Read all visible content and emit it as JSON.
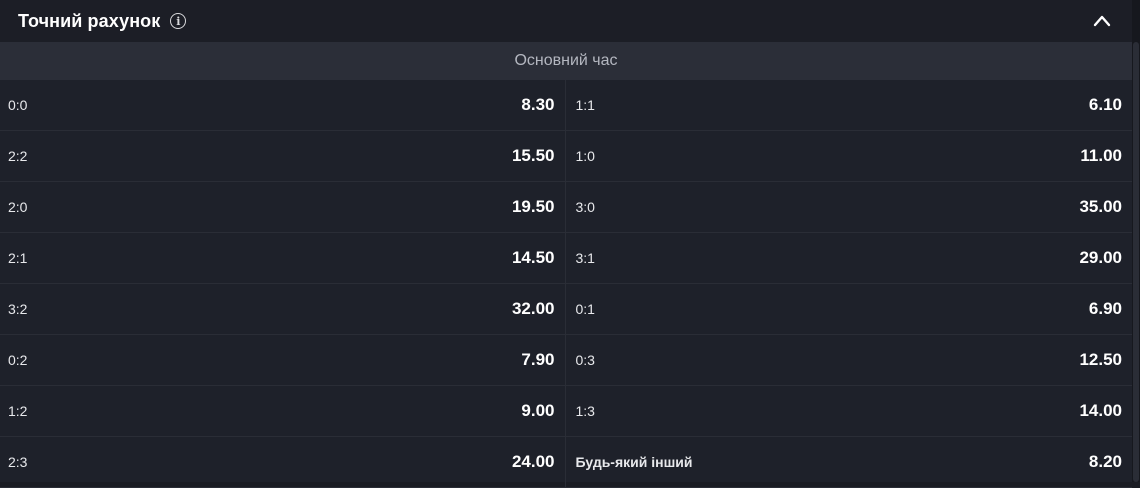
{
  "market": {
    "title": "Точний рахунок",
    "period": "Основний час",
    "info_icon": "info-icon",
    "collapse_icon": "chevron-up-icon"
  },
  "rows": [
    {
      "left": {
        "score": "0:0",
        "odds": "8.30"
      },
      "right": {
        "score": "1:1",
        "odds": "6.10"
      }
    },
    {
      "left": {
        "score": "2:2",
        "odds": "15.50"
      },
      "right": {
        "score": "1:0",
        "odds": "11.00"
      }
    },
    {
      "left": {
        "score": "2:0",
        "odds": "19.50"
      },
      "right": {
        "score": "3:0",
        "odds": "35.00"
      }
    },
    {
      "left": {
        "score": "2:1",
        "odds": "14.50"
      },
      "right": {
        "score": "3:1",
        "odds": "29.00"
      }
    },
    {
      "left": {
        "score": "3:2",
        "odds": "32.00"
      },
      "right": {
        "score": "0:1",
        "odds": "6.90"
      }
    },
    {
      "left": {
        "score": "0:2",
        "odds": "7.90"
      },
      "right": {
        "score": "0:3",
        "odds": "12.50"
      }
    },
    {
      "left": {
        "score": "1:2",
        "odds": "9.00"
      },
      "right": {
        "score": "1:3",
        "odds": "14.00"
      }
    },
    {
      "left": {
        "score": "2:3",
        "odds": "24.00"
      },
      "right": {
        "score": "Будь-який інший",
        "odds": "8.20"
      }
    }
  ]
}
